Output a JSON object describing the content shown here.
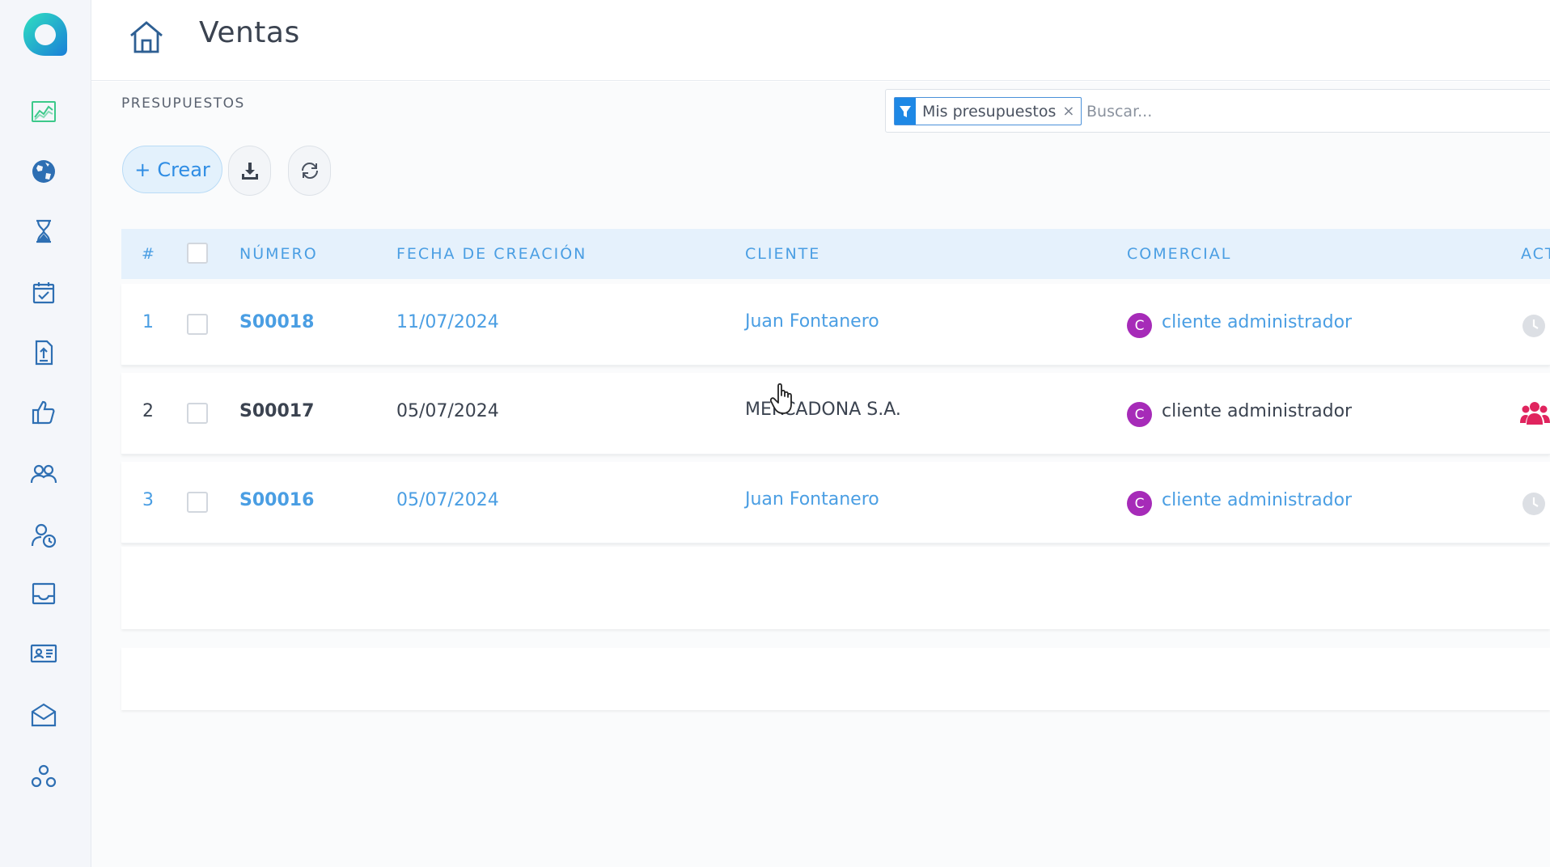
{
  "header": {
    "title": "Ventas"
  },
  "section": {
    "label": "PRESUPUESTOS"
  },
  "search": {
    "filter_chip": "Mis presupuestos",
    "chip_close": "×",
    "placeholder": "Buscar..."
  },
  "toolbar": {
    "create_icon": "+",
    "create_label": "Crear"
  },
  "table": {
    "headers": {
      "index": "#",
      "number": "NÚMERO",
      "date": "FECHA DE CREACIÓN",
      "client": "CLIENTE",
      "sales": "COMERCIAL",
      "actions": "ACT"
    },
    "rows": [
      {
        "index": "1",
        "number": "S00018",
        "date": "11/07/2024",
        "client": "Juan Fontanero",
        "avatar": "C",
        "sales": "cliente administrador"
      },
      {
        "index": "2",
        "number": "S00017",
        "date": "05/07/2024",
        "client": "MERCADONA S.A.",
        "avatar": "C",
        "sales": "cliente administrador"
      },
      {
        "index": "3",
        "number": "S00016",
        "date": "05/07/2024",
        "client": "Juan Fontanero",
        "avatar": "C",
        "sales": "cliente administrador"
      }
    ]
  },
  "sidebar": {
    "icons": [
      "chart-icon",
      "globe-icon",
      "hourglass-icon",
      "calendar-check-icon",
      "document-upload-icon",
      "thumbs-up-icon",
      "users-icon",
      "user-clock-icon",
      "inbox-icon",
      "id-card-icon",
      "envelope-icon",
      "modules-icon"
    ]
  },
  "colors": {
    "accent": "#2f8de4",
    "link": "#4a9ee3",
    "avatar": "#a62bb8",
    "sidebar_icon": "#2e6fb3",
    "chart_icon": "#3cc98a"
  }
}
